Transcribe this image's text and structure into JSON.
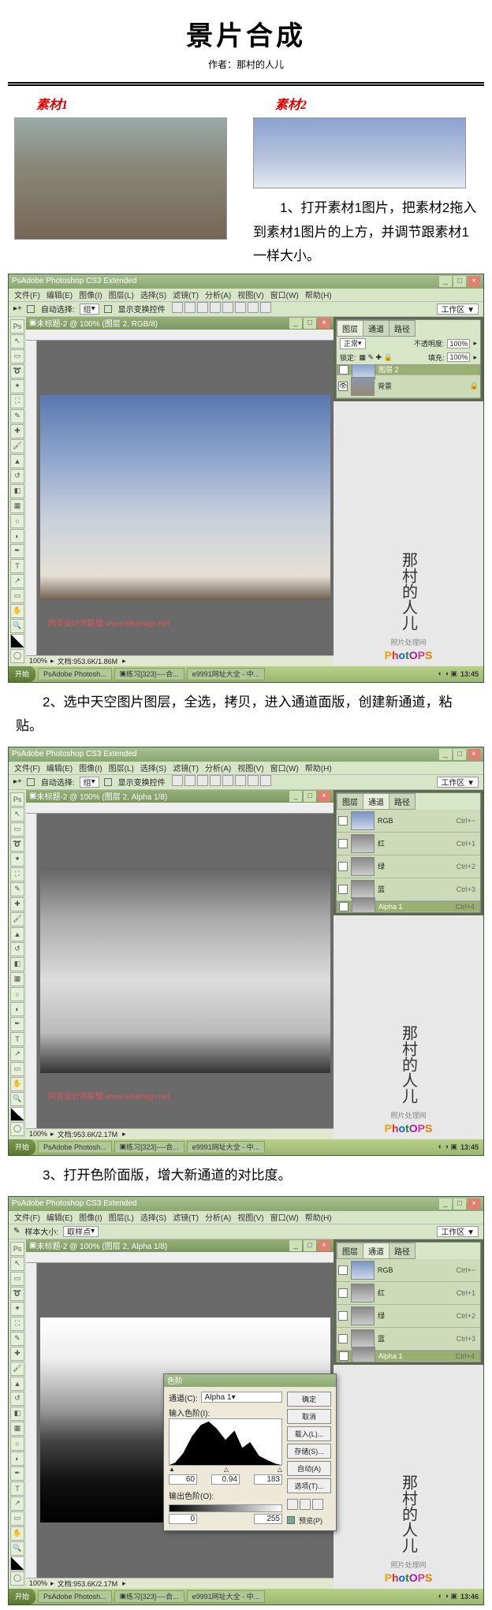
{
  "header": {
    "title": "景片合成",
    "author_line": "作者：那村的人儿"
  },
  "mat1_label": "素材1",
  "mat2_label": "素材2",
  "step1": "1、打开素材1图片，把素材2拖入到素材1图片的上方，并调节跟素材1一样大小。",
  "step2": "2、选中天空图片图层，全选，拷贝，进入通道面版，创建新通道，粘贴。",
  "step3": "3、打开色阶面版，增大新通道的对比度。",
  "ps": {
    "title": "Adobe Photoshop CS3 Extended",
    "menu": [
      "文件(F)",
      "编辑(E)",
      "图像(I)",
      "图层(L)",
      "选择(S)",
      "滤镜(T)",
      "分析(A)",
      "视图(V)",
      "窗口(W)",
      "帮助(H)"
    ],
    "opt_auto": "自动选择:",
    "opt_group": "组",
    "opt_show": "显示变换控件",
    "opt_work": "工作区 ▼",
    "doc1": "未标题-2 @ 100% (图层 2, RGB/8)",
    "doc2": "未标题-2 @ 100% (图层 2, Alpha 1/8)",
    "doc3": "未标题-2 @ 100% (图层 2, Alpha 1/8)",
    "layer_tabs": [
      "图层",
      "通道",
      "路径"
    ],
    "blend": "正常",
    "opacity_l": "不透明度:",
    "opacity_v": "100%",
    "lock_l": "锁定:",
    "fill_l": "填充:",
    "fill_v": "100%",
    "layer2": "图层 2",
    "bg": "背景",
    "rgb": "RGB",
    "red": "红",
    "green": "绿",
    "blue": "蓝",
    "alpha": "Alpha 1",
    "sc_rgb": "Ctrl+~",
    "sc_r": "Ctrl+1",
    "sc_g": "Ctrl+2",
    "sc_b": "Ctrl+3",
    "sc_a": "Ctrl+4",
    "zoom": "100%",
    "docsize1": "文档:953.6K/1.86M",
    "docsize2": "文档:953.6K/2.17M",
    "docsize3": "文档:953.6K/2.17M",
    "logo_label": "照片处理网",
    "watermark": "网页设计师联盟  www.68design.net"
  },
  "taskbar": {
    "start": "开始",
    "btn1": "Adobe Photosh...",
    "btn2": "练习[323]----合...",
    "btn3": "9991网址大全 - 中...",
    "clock": "13:45",
    "clock3": "13:46"
  },
  "opt3": {
    "label": "样本大小:",
    "val": "取样点"
  },
  "levels": {
    "title": "色阶",
    "channel_l": "通道(C):",
    "channel": "Alpha 1",
    "input_l": "输入色阶(I):",
    "v1": "60",
    "v2": "0.94",
    "v3": "183",
    "output_l": "输出色阶(O):",
    "o1": "0",
    "o2": "255",
    "ok": "确定",
    "cancel": "取消",
    "load": "载入(L)...",
    "save": "存储(S)...",
    "auto": "自动(A)",
    "options": "选项(T)...",
    "preview": "预览(P)"
  }
}
